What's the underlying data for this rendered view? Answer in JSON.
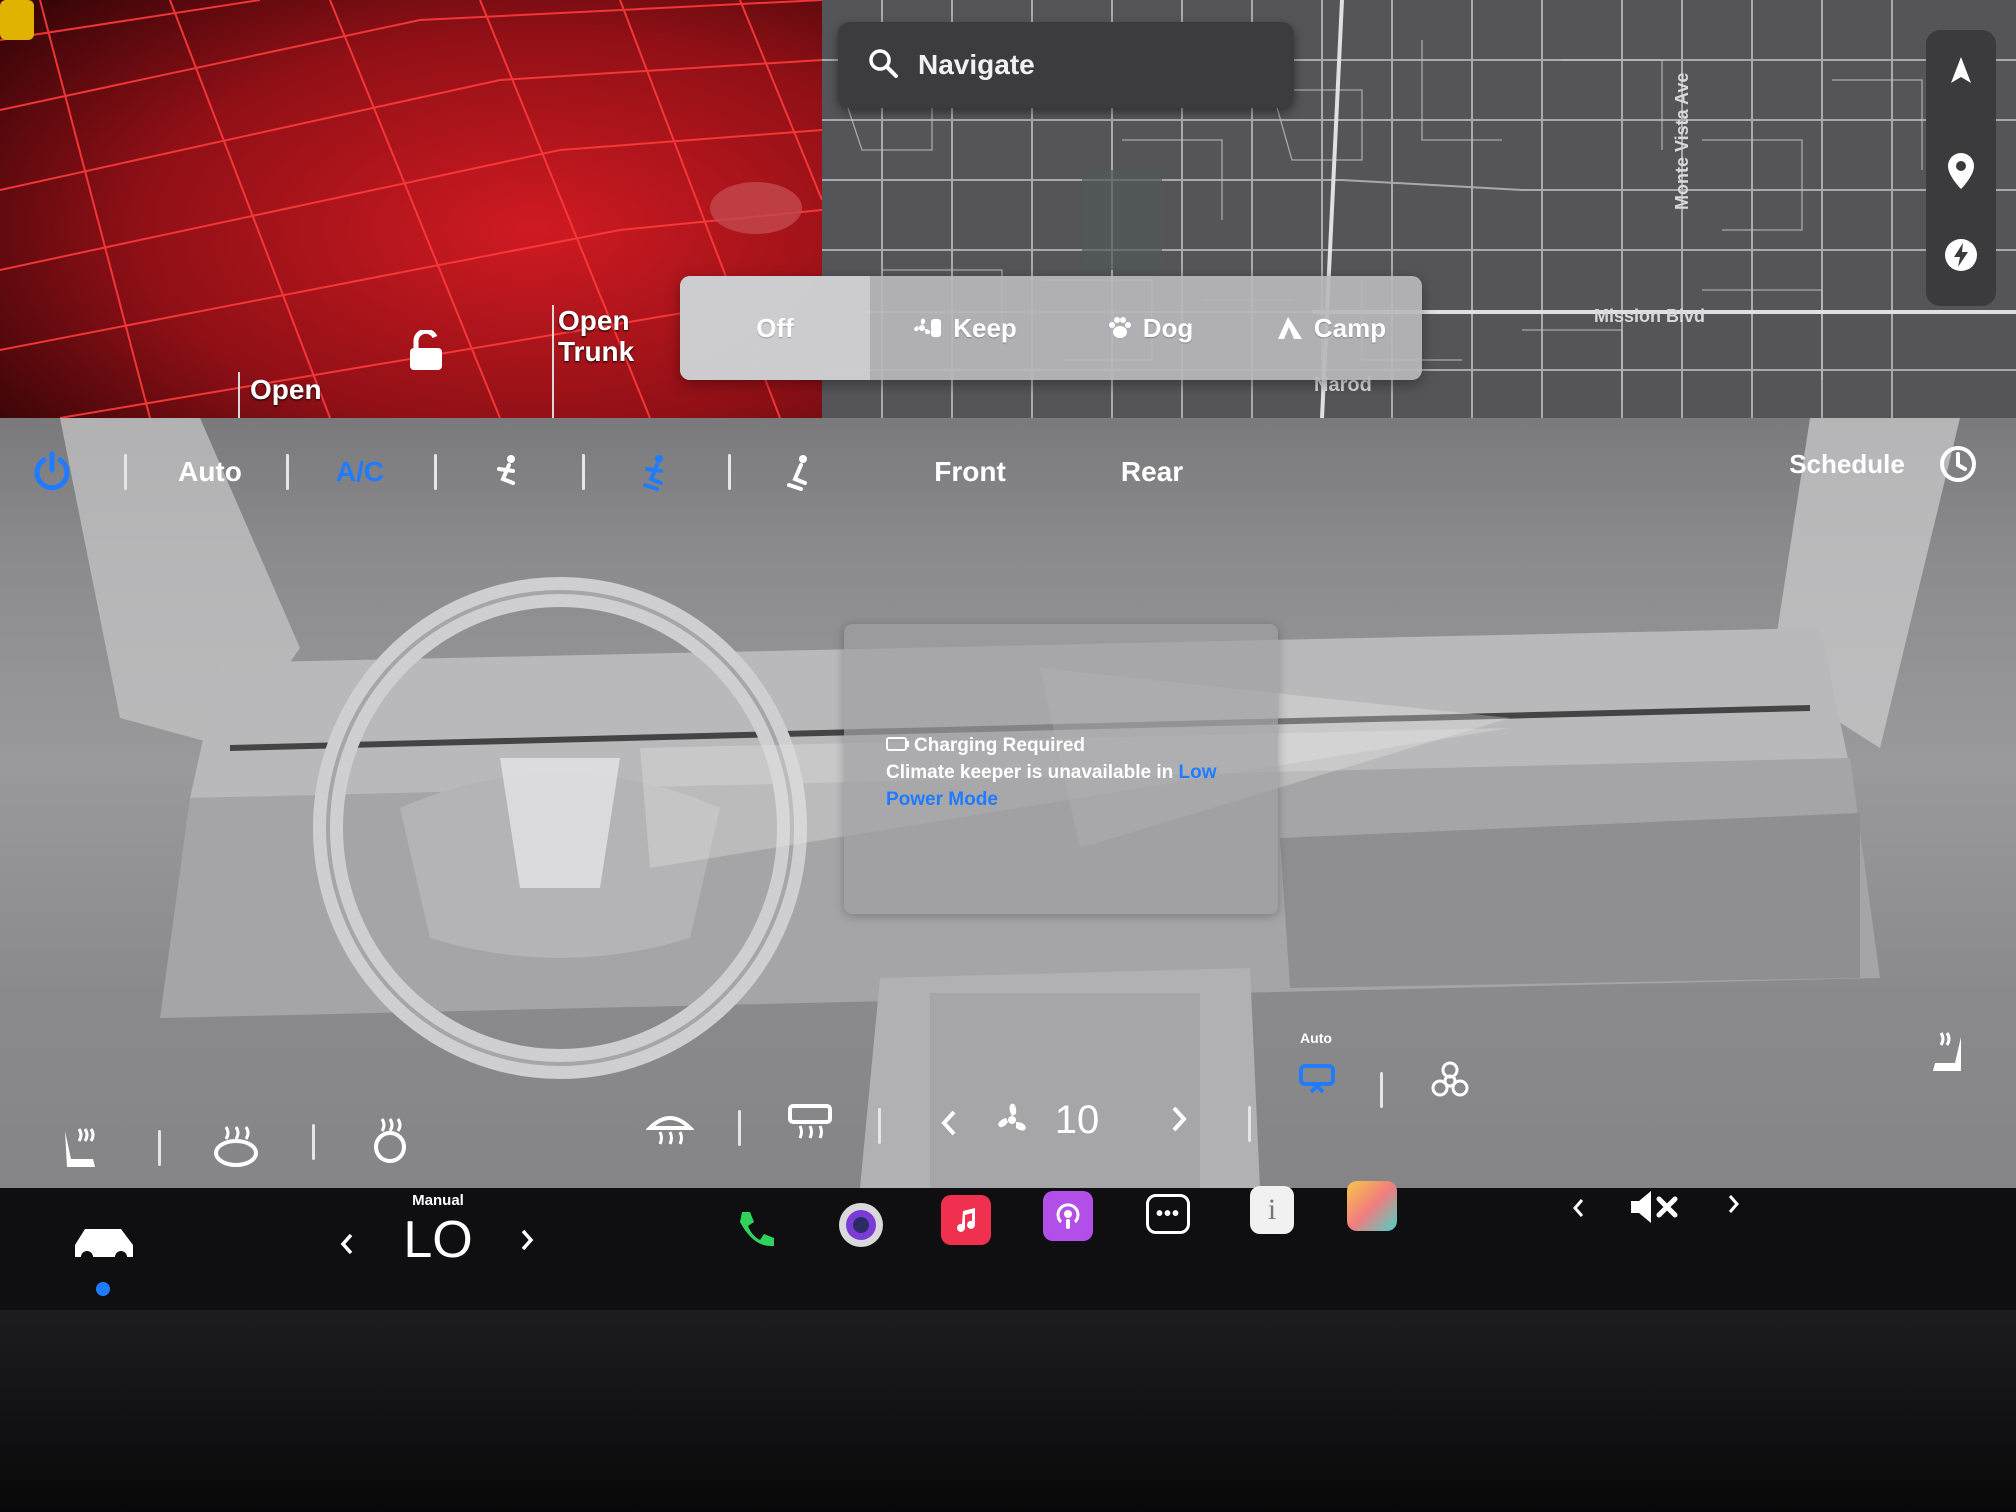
{
  "visualization": {
    "open_trunk_label": "Open Trunk",
    "open_frunk_label": "Open",
    "colors": {
      "background": "#4c0a0d",
      "grid": "#ff2a2a"
    }
  },
  "map": {
    "search_placeholder": "Navigate",
    "street_labels": [
      "Mission Blvd",
      "Monte Vista Ave",
      "Narod"
    ],
    "controls": [
      "compass-icon",
      "pin-icon",
      "charging-icon"
    ]
  },
  "climate_keeper": {
    "options": [
      {
        "label": "Off",
        "icon": "none",
        "selected": true
      },
      {
        "label": "Keep",
        "icon": "fan-icon",
        "selected": false
      },
      {
        "label": "Dog",
        "icon": "paw-icon",
        "selected": false
      },
      {
        "label": "Camp",
        "icon": "tent-icon",
        "selected": false
      }
    ]
  },
  "climate": {
    "toolbar": {
      "power": "power-icon",
      "auto_label": "Auto",
      "ac_label": "A/C",
      "front_label": "Front",
      "rear_label": "Rear",
      "schedule_label": "Schedule"
    },
    "warning": {
      "title": "Charging Required",
      "body": "Climate keeper is unavailable in",
      "link": "Low Power Mode"
    },
    "fan_speed": "10",
    "recirc_mode_label": "Auto",
    "accent_color": "#1f7bff"
  },
  "taskbar": {
    "temperature_mode": "Manual",
    "temperature_value": "LO",
    "apps": [
      "phone-icon",
      "camera-icon",
      "music-icon",
      "podcasts-icon",
      "more-icon",
      "manual-icon",
      "toybox-icon"
    ],
    "volume_icon": "volume-muted-icon"
  }
}
